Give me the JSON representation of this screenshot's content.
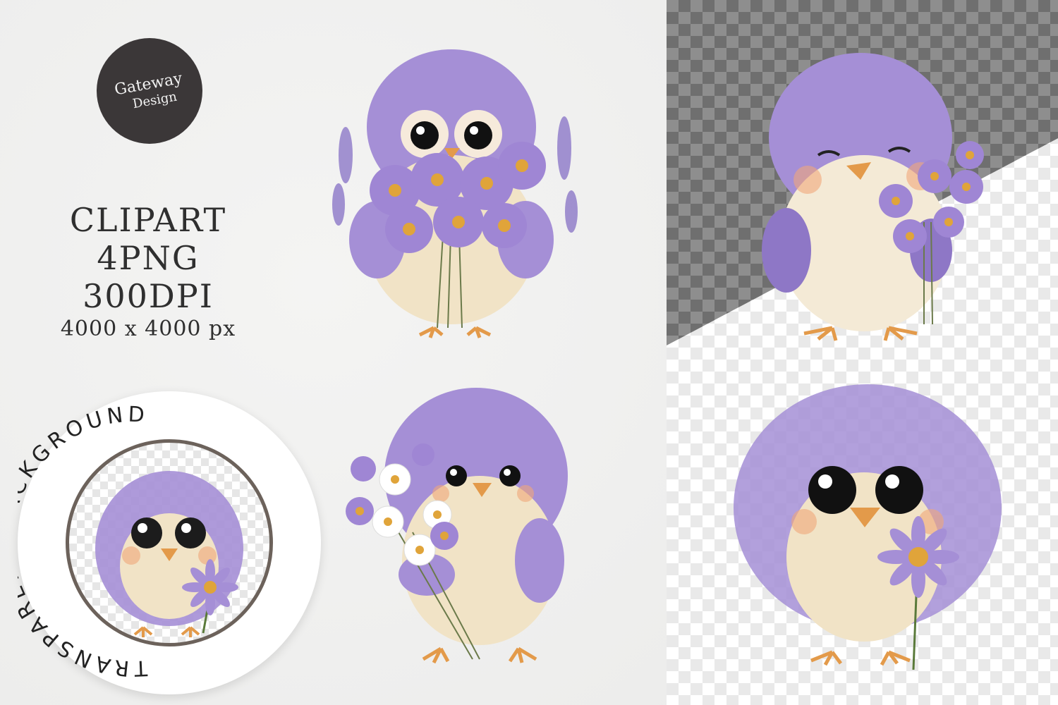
{
  "brand": {
    "line1": "Gateway",
    "line2": "Design"
  },
  "specs": {
    "line1": "CLIPART",
    "line2": "4PNG",
    "line3": "300DPI",
    "line4": "4000 x 4000 px"
  },
  "badge": {
    "text": "TRANSPARENT  BACKGROUND"
  },
  "colors": {
    "lavender": "#a58fd6",
    "lavender_dark": "#7a62b5",
    "cream": "#f1e3c6",
    "beak": "#e39a4a",
    "logo_bg": "#3b3738"
  }
}
